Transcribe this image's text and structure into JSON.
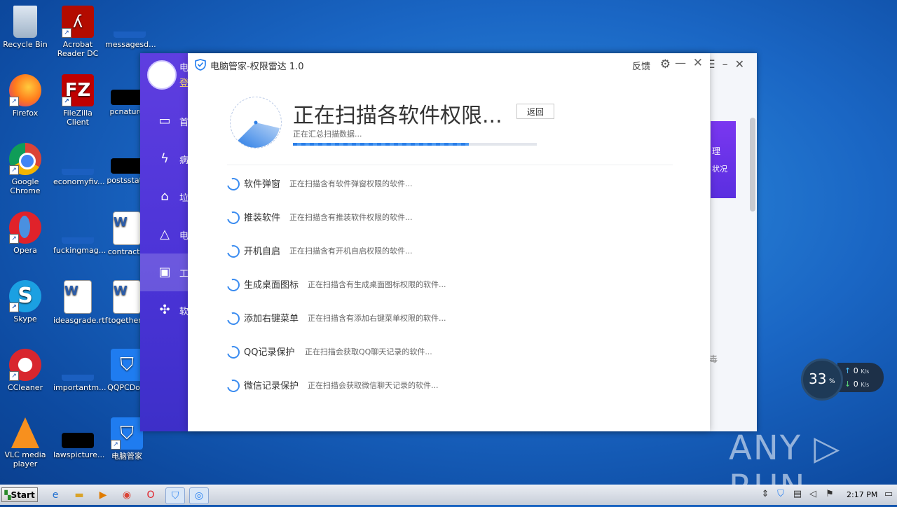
{
  "desktop": {
    "icons": [
      {
        "label": "Recycle Bin"
      },
      {
        "label": "Acrobat Reader DC"
      },
      {
        "label": "messagesd..."
      },
      {
        "label": "Firefox"
      },
      {
        "label": "FileZilla Client"
      },
      {
        "label": "pcnature"
      },
      {
        "label": "Google Chrome"
      },
      {
        "label": "economyfiv..."
      },
      {
        "label": "postsstate"
      },
      {
        "label": "Opera"
      },
      {
        "label": "fuckingmag..."
      },
      {
        "label": "contractsi"
      },
      {
        "label": "Skype"
      },
      {
        "label": "ideasgrade.rtf"
      },
      {
        "label": "togetherc"
      },
      {
        "label": "CCleaner"
      },
      {
        "label": "importantm..."
      },
      {
        "label": "QQPCDow"
      },
      {
        "label": "VLC media player"
      },
      {
        "label": "lawspicture..."
      },
      {
        "label": "电脑管家"
      }
    ]
  },
  "back_window": {
    "title_fragment": "电",
    "login_fragment": "登",
    "sidebar": [
      {
        "label": "首",
        "icon": "monitor-icon"
      },
      {
        "label": "病",
        "icon": "lightning-icon"
      },
      {
        "label": "垃",
        "icon": "broom-icon"
      },
      {
        "label": "电",
        "icon": "rocket-icon"
      },
      {
        "label": "工",
        "icon": "toolbox-icon"
      },
      {
        "label": "软",
        "icon": "apps-icon"
      }
    ],
    "banner_text_1": "理",
    "banner_text_2": "状况",
    "side_fragment": "毒"
  },
  "front_window": {
    "title": "电脑管家-权限雷达 1.0",
    "feedback": "反馈",
    "scan_title": "正在扫描各软件权限...",
    "scan_subtitle": "正在汇总扫描数据...",
    "back_button": "返回",
    "progress": 0.72,
    "rows": [
      {
        "name": "软件弹窗",
        "desc": "正在扫描含有软件弹窗权限的软件..."
      },
      {
        "name": "推装软件",
        "desc": "正在扫描含有推装软件权限的软件..."
      },
      {
        "name": "开机自启",
        "desc": "正在扫描含有开机自启权限的软件..."
      },
      {
        "name": "生成桌面图标",
        "desc": "正在扫描含有生成桌面图标权限的软件..."
      },
      {
        "name": "添加右键菜单",
        "desc": "正在扫描含有添加右键菜单权限的软件..."
      },
      {
        "name": "QQ记录保护",
        "desc": "正在扫描会获取QQ聊天记录的软件..."
      },
      {
        "name": "微信记录保护",
        "desc": "正在扫描会获取微信聊天记录的软件..."
      }
    ]
  },
  "net_widget": {
    "percent": "33",
    "percent_sign": "%",
    "up": "0",
    "down": "0",
    "unit": "K/s"
  },
  "watermark": "ANY ▷ RUN",
  "taskbar": {
    "start": "Start",
    "time": "2:17 PM"
  }
}
